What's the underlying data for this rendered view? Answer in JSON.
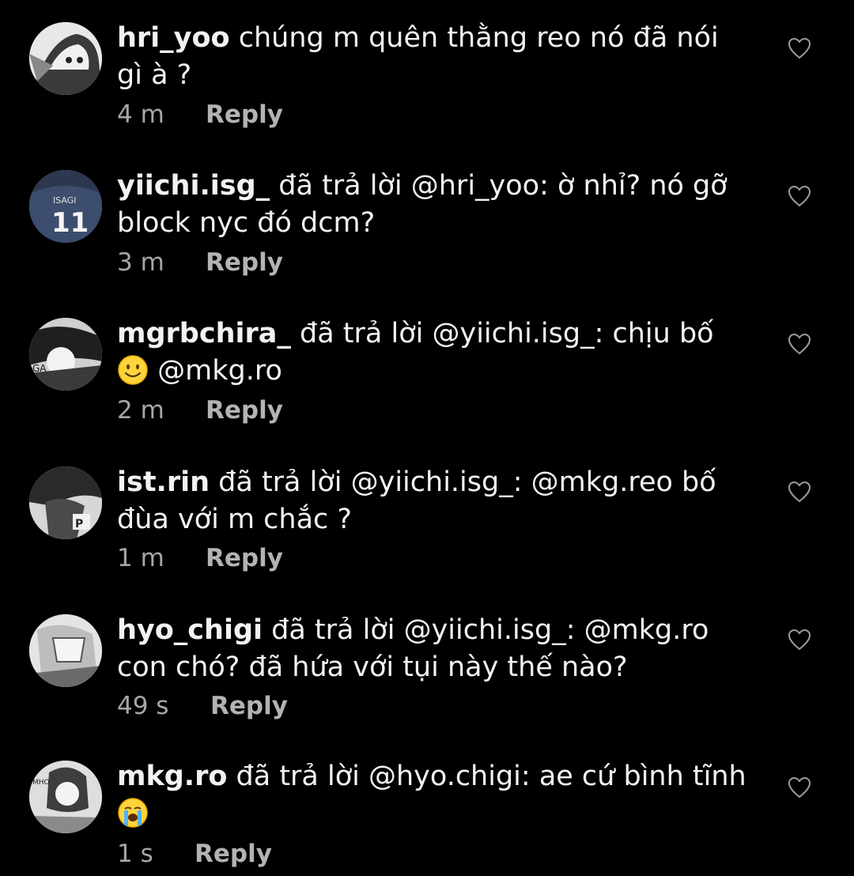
{
  "comments": [
    {
      "username": "hri_yoo",
      "text_before": " chúng m quên thằng reo nó đã nói gì à ?",
      "emoji": "",
      "text_after": "",
      "time": "4 m",
      "reply_label": "Reply"
    },
    {
      "username": "yiichi.isg_",
      "text_before": " đã trả lời @hri_yoo: ờ nhỉ? nó gỡ block nyc đó dcm?",
      "emoji": "",
      "text_after": "",
      "time": "3 m",
      "reply_label": "Reply"
    },
    {
      "username": "mgrbchira_",
      "text_before": " đã trả lời @yiichi.isg_: chịu bố ",
      "emoji": "slightly-smiling-face",
      "text_after": " @mkg.ro",
      "time": "2 m",
      "reply_label": "Reply"
    },
    {
      "username": "ist.rin",
      "text_before": " đã trả lời @yiichi.isg_: @mkg.reo bố đùa với m chắc ?",
      "emoji": "",
      "text_after": "",
      "time": "1 m",
      "reply_label": "Reply"
    },
    {
      "username": "hyo_chigi",
      "text_before": " đã trả lời @yiichi.isg_: @mkg.ro con chó? đã hứa với tụi này thế nào?",
      "emoji": "",
      "text_after": "",
      "time": "49 s",
      "reply_label": "Reply"
    },
    {
      "username": "mkg.ro",
      "text_before": " đã trả lời @hyo.chigi: ae cứ bình tĩnh ",
      "emoji": "loudly-crying-face",
      "text_after": "",
      "time": "1 s",
      "reply_label": "Reply"
    }
  ],
  "icons": {
    "like": "heart-outline-icon"
  },
  "colors": {
    "background": "#000000",
    "text": "#f2f2f2",
    "meta": "#a6a6a6",
    "heart": "#9a9a9a"
  }
}
